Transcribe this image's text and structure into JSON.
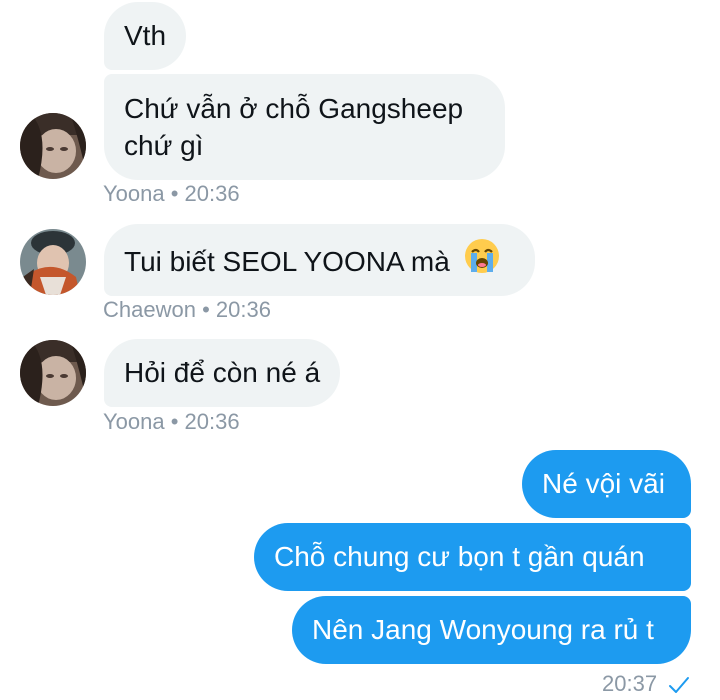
{
  "messages": [
    {
      "text": "Vth"
    },
    {
      "text_line1": "Chứ vẫn ở chỗ Gangsheep",
      "text_line2": "chứ gì"
    },
    {
      "meta": "Yoona • 20:36"
    },
    {
      "text": "Tui biết SEOL YOONA mà",
      "emoji": "loudly-crying-face"
    },
    {
      "meta": "Chaewon • 20:36"
    },
    {
      "text": "Hỏi để còn né á"
    },
    {
      "meta": "Yoona • 20:36"
    },
    {
      "text": "Né vội vãi"
    },
    {
      "text": "Chỗ chung cư bọn t gần quán"
    },
    {
      "text": "Nên Jang Wonyoung ra rủ t"
    },
    {
      "meta": "20:37",
      "status_icon": "read-check-icon"
    }
  ],
  "colors": {
    "received_bubble": "#eff3f4",
    "sent_bubble": "#1d9bf0",
    "meta_text": "#8b98a5",
    "check": "#1d9bf0"
  }
}
